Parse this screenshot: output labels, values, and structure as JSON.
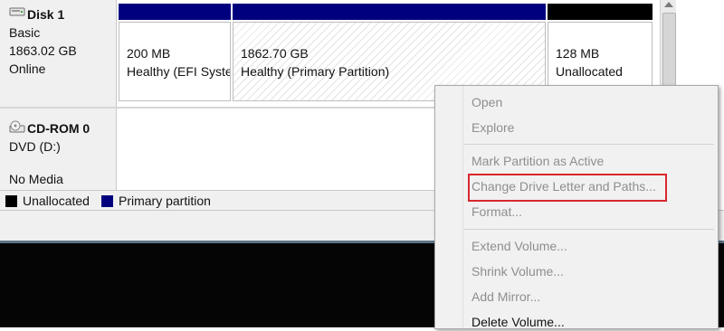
{
  "disk1": {
    "title": "Disk 1",
    "type": "Basic",
    "size": "1863.02 GB",
    "status": "Online",
    "icon": "hard-disk-icon",
    "partitions": [
      {
        "size": "200 MB",
        "status": "Healthy (EFI System Partition)",
        "header_color": "#00007f"
      },
      {
        "size": "1862.70 GB",
        "status": "Healthy (Primary Partition)",
        "header_color": "#00007f"
      },
      {
        "size": "128 MB",
        "status": "Unallocated",
        "header_color": "#000000"
      }
    ]
  },
  "cdrom": {
    "title": "CD-ROM 0",
    "drive": "DVD (D:)",
    "media": "No Media",
    "icon": "cd-rom-icon"
  },
  "legend": [
    {
      "label": "Unallocated",
      "color": "#000000"
    },
    {
      "label": "Primary partition",
      "color": "#00007f"
    }
  ],
  "context_menu": {
    "items": [
      {
        "label": "Open",
        "enabled": false
      },
      {
        "label": "Explore",
        "enabled": false
      },
      {
        "label": "Mark Partition as Active",
        "enabled": false
      },
      {
        "label": "Change Drive Letter and Paths...",
        "enabled": false,
        "highlighted": true
      },
      {
        "label": "Format...",
        "enabled": false
      },
      {
        "label": "Extend Volume...",
        "enabled": false
      },
      {
        "label": "Shrink Volume...",
        "enabled": false
      },
      {
        "label": "Add Mirror...",
        "enabled": false
      },
      {
        "label": "Delete Volume...",
        "enabled": true
      }
    ],
    "highlight_color": "#d9272d"
  }
}
